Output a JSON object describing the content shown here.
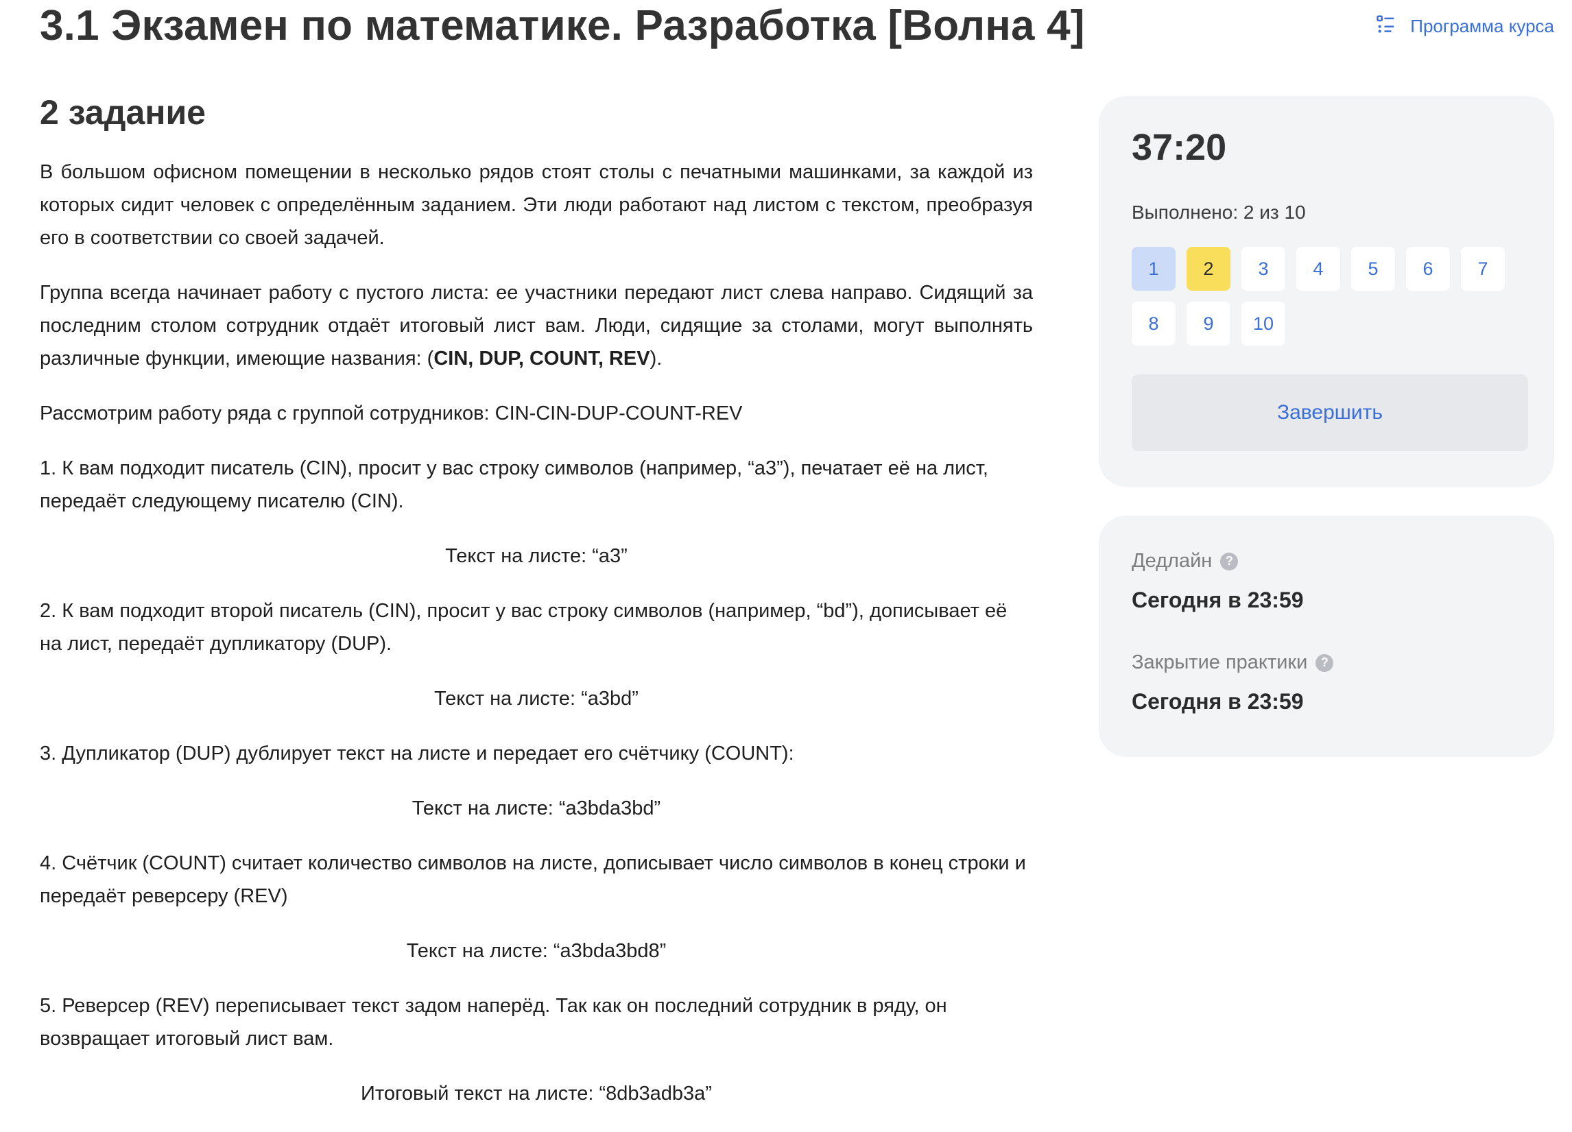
{
  "header": {
    "title": "3.1 Экзамен по математике. Разработка [Волна 4]",
    "program_link": "Программа курса"
  },
  "task": {
    "title": "2 задание",
    "intro": "В большом офисном помещении в несколько рядов стоят столы с печатными машинками, за каждой из которых сидит человек с определённым заданием. Эти люди работают над листом с текстом, преобразуя его в соответствии со своей задачей.",
    "group_text": "Группа всегда начинает работу с пустого листа: ее участники передают лист слева направо. Сидящий за последним столом сотрудник отдаёт итоговый лист вам. Люди, сидящие за столами, могут выполнять различные функции, имеющие названия: (",
    "functions": "CIN, DUP, COUNT, REV",
    "group_close": ").",
    "example_intro": "Рассмотрим работу ряда с группой сотрудников: CIN-CIN-DUP-COUNT-REV",
    "steps": [
      {
        "text": "1. К вам подходит писатель (CIN), просит у вас строку символов (например, “a3”), печатает её на лист, передаёт следующему писателю (CIN).",
        "result": "Текст на листе: “a3”"
      },
      {
        "text": "2. К вам подходит второй писатель (CIN), просит у вас строку символов (например, “bd”), дописывает её на лист, передаёт дупликатору (DUP).",
        "result": "Текст на листе: “a3bd”"
      },
      {
        "text": "3. Дупликатор (DUP) дублирует текст на листе и передает его счётчику (COUNT):",
        "result": "Текст на листе: “a3bda3bd”"
      },
      {
        "text": "4. Счётчик (COUNT) считает количество символов на листе, дописывает число символов в конец строки и передаёт реверсеру (REV)",
        "result": "Текст на листе: “a3bda3bd8”"
      },
      {
        "text": "5. Реверсер (REV) переписывает текст задом наперёд. Так как он последний сотрудник в ряду, он возвращает итоговый лист вам.",
        "result": "Итоговый текст на листе: “8db3adb3a”"
      }
    ]
  },
  "sidebar": {
    "timer": "37:20",
    "progress": "Выполнено: 2 из 10",
    "questions": [
      "1",
      "2",
      "3",
      "4",
      "5",
      "6",
      "7",
      "8",
      "9",
      "10"
    ],
    "finish_label": "Завершить",
    "deadline_label": "Дедлайн",
    "deadline_value": "Сегодня в 23:59",
    "closing_label": "Закрытие практики",
    "closing_value": "Сегодня в 23:59",
    "help_glyph": "?"
  },
  "colors": {
    "accent": "#3a6fd8",
    "current_question_bg": "#ccdcf8",
    "done_question_bg": "#f8de5a",
    "card_bg": "#f3f4f6"
  }
}
